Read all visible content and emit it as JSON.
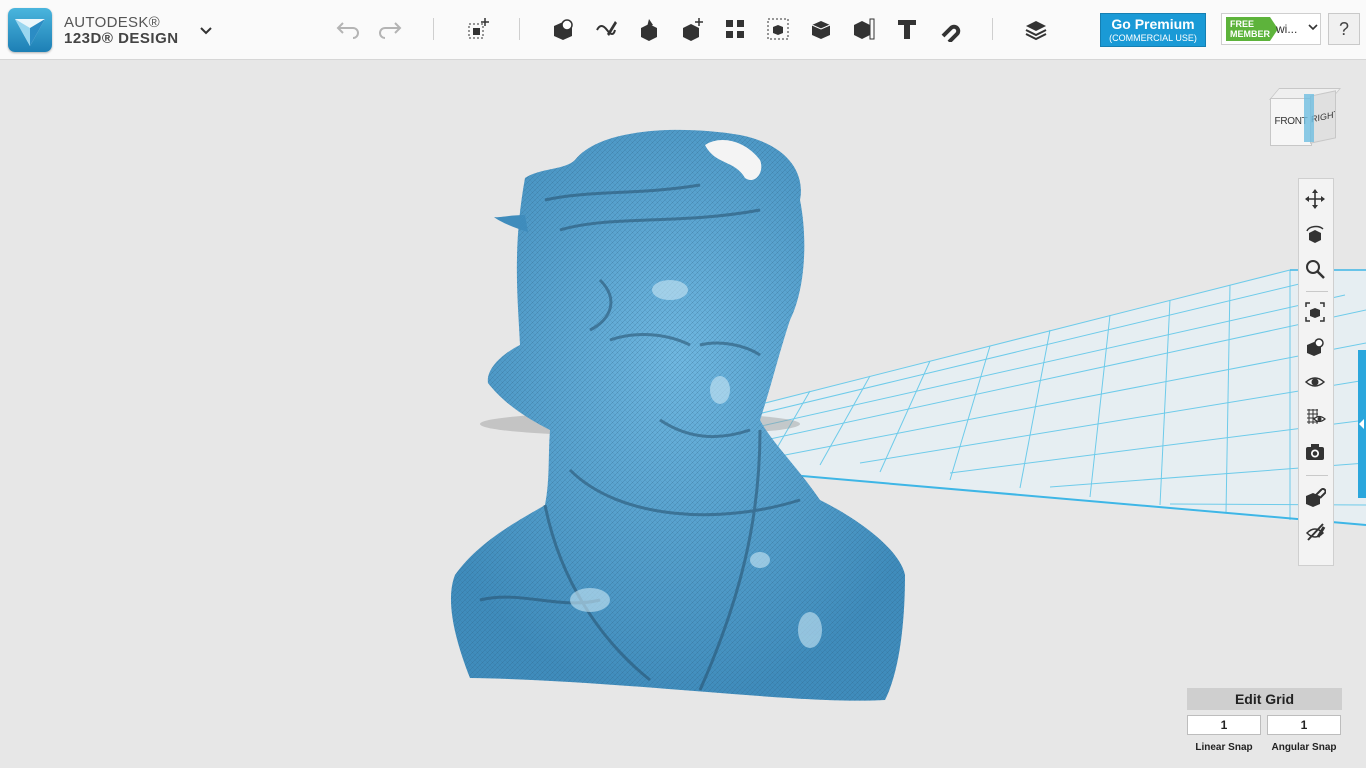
{
  "app": {
    "brand_line1": "AUTODESK®",
    "brand_line2": "123D® DESIGN"
  },
  "toolbar": {
    "menu_icon": "chevron-down-icon",
    "tools": [
      {
        "name": "undo-icon"
      },
      {
        "name": "redo-icon"
      },
      {
        "name": "transform-icon"
      },
      {
        "name": "primitives-icon"
      },
      {
        "name": "sketch-icon"
      },
      {
        "name": "construct-icon"
      },
      {
        "name": "modify-icon"
      },
      {
        "name": "pattern-icon"
      },
      {
        "name": "group-icon"
      },
      {
        "name": "combine-icon"
      },
      {
        "name": "measure-icon"
      },
      {
        "name": "text-icon"
      },
      {
        "name": "snap-icon"
      },
      {
        "name": "materials-icon"
      }
    ]
  },
  "premium": {
    "title": "Go Premium",
    "subtitle": "(COMMERCIAL USE)"
  },
  "member": {
    "badge_line1": "FREE",
    "badge_line2": "MEMBER",
    "username": "wi..."
  },
  "help_label": "?",
  "viewcube": {
    "front_label": "FRONT",
    "right_label": "RIGHT"
  },
  "colors": {
    "accent": "#1a9ad6",
    "model": "#4a9ccd",
    "grid": "#5bc2e6",
    "badge": "#5db33b"
  },
  "edit_grid": {
    "title": "Edit Grid",
    "linear_snap_value": "1",
    "angular_snap_value": "1",
    "linear_snap_label": "Linear Snap",
    "angular_snap_label": "Angular Snap"
  }
}
